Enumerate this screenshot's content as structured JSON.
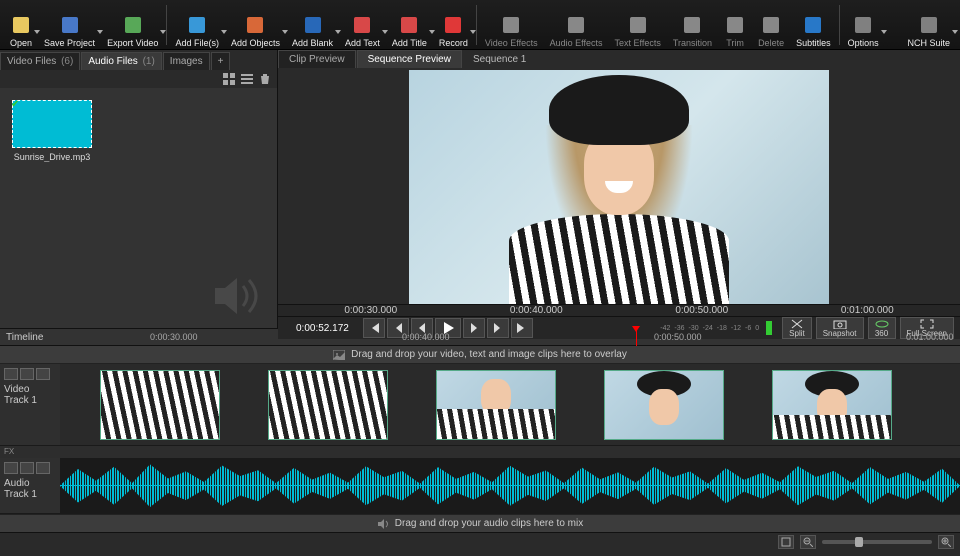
{
  "toolbar": {
    "items": [
      {
        "id": "open",
        "label": "Open",
        "color": "#e8c860",
        "dd": true
      },
      {
        "id": "save-project",
        "label": "Save Project",
        "color": "#4878c8",
        "dd": true
      },
      {
        "id": "export-video",
        "label": "Export Video",
        "color": "#58a858",
        "dd": true
      },
      {
        "id": "add-files",
        "label": "Add File(s)",
        "color": "#3898d8",
        "dd": true
      },
      {
        "id": "add-objects",
        "label": "Add Objects",
        "color": "#d86838",
        "dd": true
      },
      {
        "id": "add-blank",
        "label": "Add Blank",
        "color": "#2868b8",
        "dd": true
      },
      {
        "id": "add-text",
        "label": "Add Text",
        "color": "#d84848",
        "dd": true
      },
      {
        "id": "add-title",
        "label": "Add Title",
        "color": "#d84848",
        "dd": true
      },
      {
        "id": "record",
        "label": "Record",
        "color": "#e03838",
        "dd": true
      },
      {
        "id": "video-effects",
        "label": "Video Effects",
        "color": "#808080",
        "dd": false,
        "muted": true
      },
      {
        "id": "audio-effects",
        "label": "Audio Effects",
        "color": "#808080",
        "dd": false,
        "muted": true
      },
      {
        "id": "text-effects",
        "label": "Text Effects",
        "color": "#808080",
        "dd": false,
        "muted": true
      },
      {
        "id": "transition",
        "label": "Transition",
        "color": "#808080",
        "dd": false,
        "muted": true
      },
      {
        "id": "trim",
        "label": "Trim",
        "color": "#808080",
        "dd": false,
        "muted": true
      },
      {
        "id": "delete",
        "label": "Delete",
        "color": "#808080",
        "dd": false,
        "muted": true
      },
      {
        "id": "subtitles",
        "label": "Subtitles",
        "color": "#2878c8",
        "dd": false
      },
      {
        "id": "options",
        "label": "Options",
        "color": "#808080",
        "dd": true
      },
      {
        "id": "nch-suite",
        "label": "NCH Suite",
        "color": "#808080",
        "dd": true,
        "right": true
      }
    ]
  },
  "bin": {
    "tabs": [
      {
        "label": "Video Files",
        "count": "(6)"
      },
      {
        "label": "Audio Files",
        "count": "(1)",
        "active": true
      },
      {
        "label": "Images",
        "count": ""
      },
      {
        "label": "+",
        "count": ""
      }
    ],
    "item_name": "Sunrise_Drive.mp3"
  },
  "preview": {
    "tabs": [
      {
        "label": "Clip Preview"
      },
      {
        "label": "Sequence Preview",
        "active": true
      }
    ],
    "sequence_label": "Sequence 1",
    "ruler": [
      "0:00:30.000",
      "0:00:40.000",
      "0:00:50.000",
      "0:01:00.000"
    ],
    "timecode": "0:00:52.172",
    "meter_labels": [
      "-42",
      "-36",
      "-30",
      "-24",
      "-18",
      "-12",
      "-6",
      "0"
    ],
    "actions": {
      "split": "Split",
      "snapshot": "Snapshot",
      "360": "360",
      "fullscreen": "Full Screen"
    }
  },
  "timeline": {
    "label": "Timeline",
    "ruler": [
      "0:00:30.000",
      "0:00:40.000",
      "0:00:50.000",
      "0:01:00.000"
    ],
    "overlay_hint": "Drag and drop your video, text and image clips here to overlay",
    "mix_hint": "Drag and drop your audio clips here to mix",
    "video_track_label": "Video Track 1",
    "audio_track_label": "Audio Track 1",
    "fx_label": "FX"
  }
}
